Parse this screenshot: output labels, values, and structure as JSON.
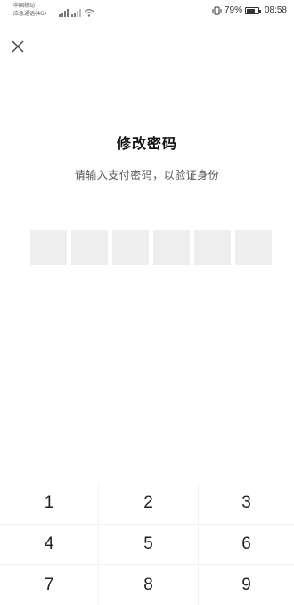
{
  "status_bar": {
    "carrier_line1": "中国移动",
    "carrier_line2": "应急通话(4G)",
    "battery_percent": "79%",
    "battery_level": 0.79,
    "time": "08:58"
  },
  "close_icon": "close-icon",
  "title": "修改密码",
  "subtitle": "请输入支付密码，以验证身份",
  "pin_length": 6,
  "keypad": {
    "keys": [
      "1",
      "2",
      "3",
      "4",
      "5",
      "6",
      "7",
      "8",
      "9"
    ]
  }
}
